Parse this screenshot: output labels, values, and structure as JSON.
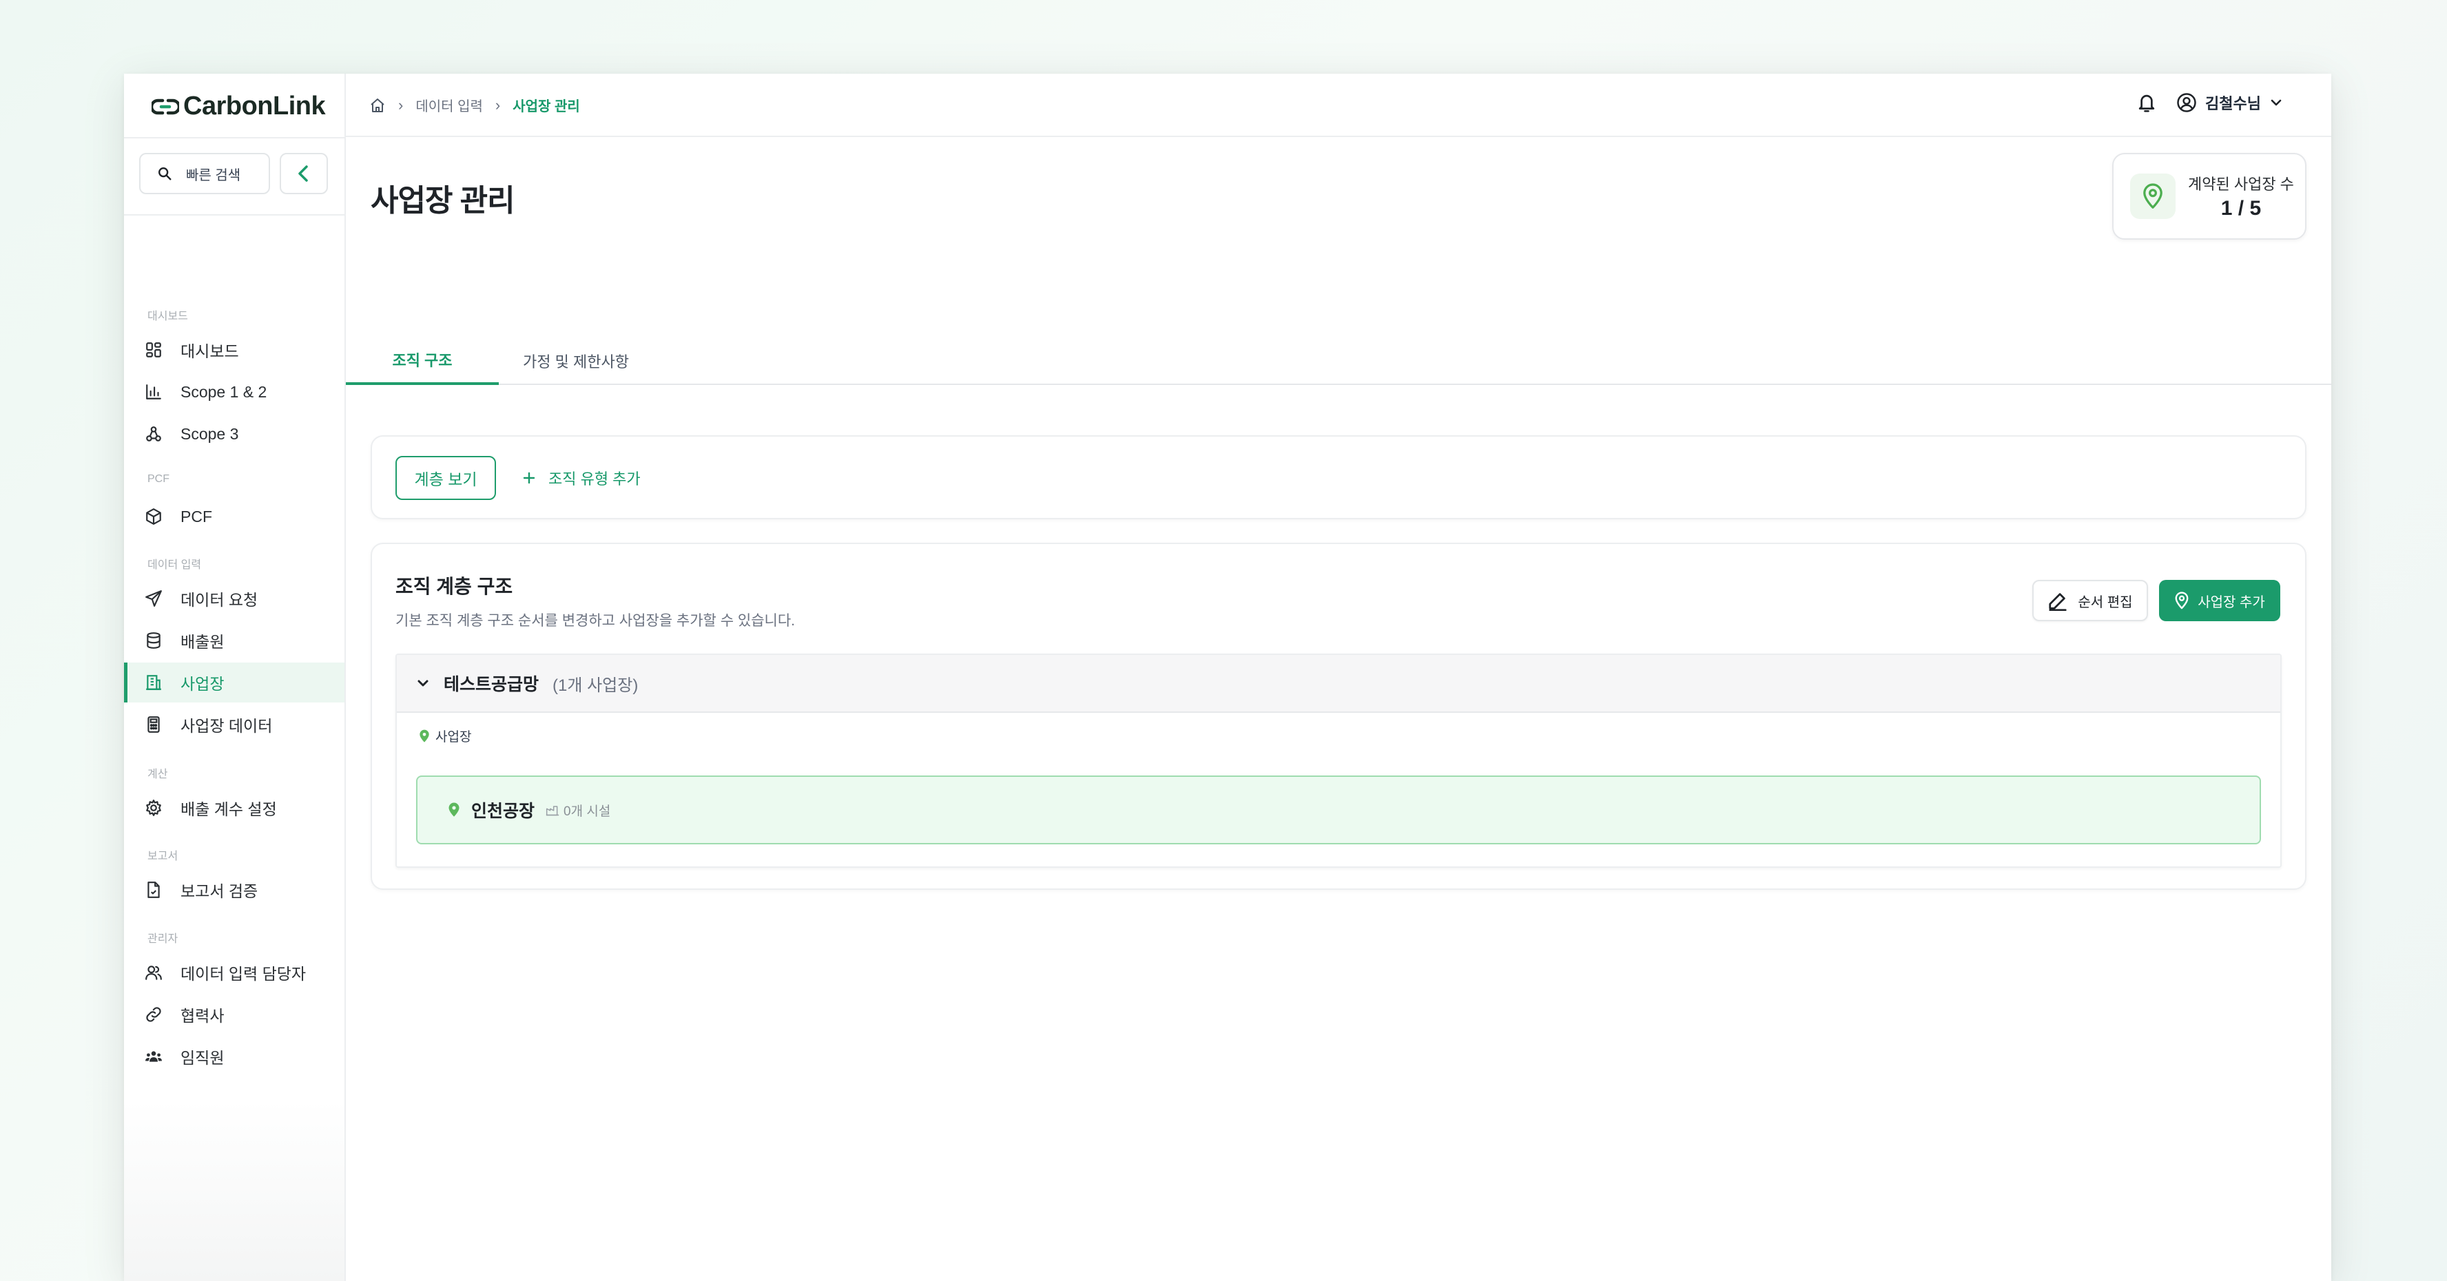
{
  "app": {
    "logo_text": "CarbonLink"
  },
  "sidebar": {
    "search_label": "빠른 검색",
    "sections": [
      {
        "label": "대시보드",
        "items": [
          {
            "label": "대시보드",
            "icon": "dashboard-grid-icon"
          },
          {
            "label": "Scope 1 & 2",
            "icon": "bar-chart-icon"
          },
          {
            "label": "Scope 3",
            "icon": "hierarchy-icon"
          }
        ]
      },
      {
        "label": "PCF",
        "items": [
          {
            "label": "PCF",
            "icon": "cube-icon"
          }
        ]
      },
      {
        "label": "데이터 입력",
        "items": [
          {
            "label": "데이터 요청",
            "icon": "send-icon"
          },
          {
            "label": "배출원",
            "icon": "database-icon"
          },
          {
            "label": "사업장",
            "icon": "building-icon",
            "active": true
          },
          {
            "label": "사업장 데이터",
            "icon": "calculator-icon"
          }
        ]
      },
      {
        "label": "계산",
        "items": [
          {
            "label": "배출 계수 설정",
            "icon": "gear-icon"
          }
        ]
      },
      {
        "label": "보고서",
        "items": [
          {
            "label": "보고서 검증",
            "icon": "document-icon"
          }
        ]
      },
      {
        "label": "관리자",
        "items": [
          {
            "label": "데이터 입력 담당자",
            "icon": "users-icon"
          },
          {
            "label": "협력사",
            "icon": "link-icon"
          },
          {
            "label": "임직원",
            "icon": "team-icon"
          }
        ]
      }
    ]
  },
  "header": {
    "breadcrumb": [
      "데이터 입력",
      "사업장 관리"
    ],
    "user_name": "김철수님"
  },
  "page": {
    "title": "사업장 관리",
    "contract_card": {
      "label": "계약된 사업장 수",
      "value": "1 / 5"
    },
    "tabs": [
      {
        "label": "조직 구조",
        "active": true
      },
      {
        "label": "가정 및 제한사항",
        "active": false
      }
    ],
    "toolbar": {
      "hierarchy_button": "계층 보기",
      "add_type_button": "조직 유형 추가"
    },
    "structure": {
      "title": "조직 계층 구조",
      "description": "기본 조직 계층 구조 순서를 변경하고 사업장을 추가할 수 있습니다.",
      "edit_order_button": "순서 편집",
      "add_site_button": "사업장 추가",
      "groups": [
        {
          "name": "테스트공급망",
          "count": "(1개 사업장)",
          "type_label": "사업장",
          "sites": [
            {
              "name": "인천공장",
              "facilities": "0개 시설"
            }
          ]
        }
      ]
    }
  },
  "colors": {
    "accent": "#1b9b6b",
    "accent_light": "#ecfaf0",
    "pin_green": "#5cb85c"
  }
}
